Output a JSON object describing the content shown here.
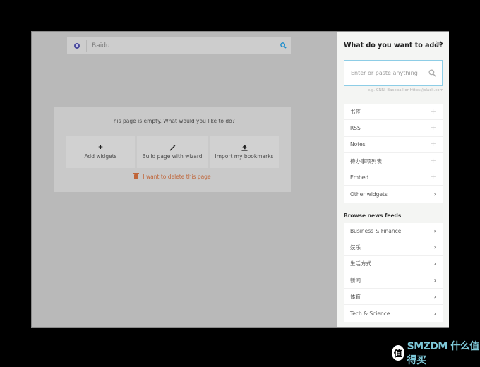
{
  "main": {
    "search": {
      "engine": "Baidu",
      "engine_icon": "baidu-icon",
      "button_icon": "search-icon"
    },
    "empty_message": "This page is empty. What would you like to do?",
    "actions": [
      {
        "label": "Add widgets",
        "icon": "+"
      },
      {
        "label": "Build page with wizard",
        "icon": "⚡"
      },
      {
        "label": "Import my bookmarks",
        "icon": "⇪"
      }
    ],
    "delete_label": "I want to delete this page"
  },
  "sidebar": {
    "title": "What do you want to add?",
    "close_icon": "✕",
    "input_placeholder": "Enter or paste anything",
    "hint": "e.g. CNN, Baseball or https://slack.com",
    "widgets": [
      {
        "label": "书签",
        "action": "+"
      },
      {
        "label": "RSS",
        "action": "+"
      },
      {
        "label": "Notes",
        "action": "+"
      },
      {
        "label": "待办事项列表",
        "action": "+"
      },
      {
        "label": "Embed",
        "action": "+"
      },
      {
        "label": "Other widgets",
        "action": "›"
      }
    ],
    "feeds_title": "Browse news feeds",
    "feeds": [
      {
        "label": "Business & Finance",
        "action": "›"
      },
      {
        "label": "娱乐",
        "action": "›"
      },
      {
        "label": "生活方式",
        "action": "›"
      },
      {
        "label": "新闻",
        "action": "›"
      },
      {
        "label": "体育",
        "action": "›"
      },
      {
        "label": "Tech & Science",
        "action": "›"
      }
    ]
  },
  "watermark": {
    "badge": "值",
    "text": "SMZDM 什么值得买"
  },
  "colors": {
    "accent_blue": "#1a8ccc",
    "delete_orange": "#c0663a",
    "input_border": "#8dcde6"
  }
}
